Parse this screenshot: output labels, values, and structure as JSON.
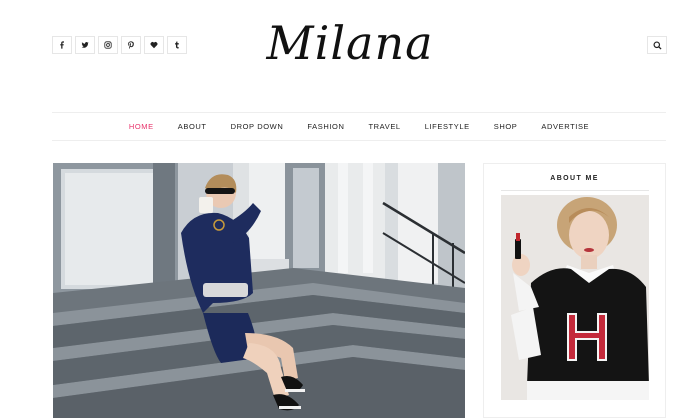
{
  "brand": {
    "logo_text": "Milana"
  },
  "social": [
    {
      "name": "facebook",
      "glyph": "f"
    },
    {
      "name": "twitter",
      "glyph": "twitter"
    },
    {
      "name": "instagram",
      "glyph": "instagram"
    },
    {
      "name": "pinterest",
      "glyph": "pinterest"
    },
    {
      "name": "bloglovin",
      "glyph": "heart"
    },
    {
      "name": "tumblr",
      "glyph": "t"
    }
  ],
  "nav": {
    "items": [
      {
        "label": "HOME",
        "active": true
      },
      {
        "label": "ABOUT",
        "active": false
      },
      {
        "label": "DROP DOWN",
        "active": false
      },
      {
        "label": "FASHION",
        "active": false
      },
      {
        "label": "TRAVEL",
        "active": false
      },
      {
        "label": "LIFESTYLE",
        "active": false
      },
      {
        "label": "SHOP",
        "active": false
      },
      {
        "label": "ADVERTISE",
        "active": false
      }
    ]
  },
  "sidebar": {
    "about_title": "ABOUT ME"
  },
  "colors": {
    "accent": "#e8336b",
    "text": "#222222",
    "border": "#eeeeee"
  },
  "icons": {
    "search": "search-icon"
  }
}
